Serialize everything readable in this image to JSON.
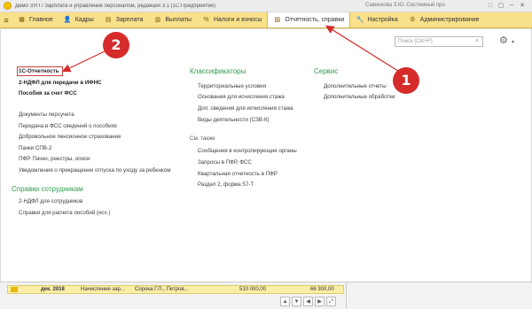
{
  "window": {
    "title": "Демо ЗУП / Зарплата и управление персоналом, редакция 3.1 (1С:Предприятие)",
    "user": "Савинкова З.Ю. Системный про",
    "controls": [
      "□",
      "▢",
      "─",
      "▢",
      "✕"
    ]
  },
  "menu": {
    "items": [
      {
        "label": "Главное",
        "icon": "▦"
      },
      {
        "label": "Кадры",
        "icon": "👤"
      },
      {
        "label": "Зарплата",
        "icon": "▤"
      },
      {
        "label": "Выплаты",
        "icon": "▥"
      },
      {
        "label": "Налоги и взносы",
        "icon": "%"
      },
      {
        "label": "Отчетность, справки",
        "icon": "▨"
      },
      {
        "label": "Настройка",
        "icon": "🔧"
      },
      {
        "label": "Администрирование",
        "icon": "⚙"
      }
    ]
  },
  "toolbar": {
    "search_placeholder": "Поиск (Ctrl+F)",
    "search_clear": "×",
    "settings_icon": "⚙",
    "settings_caret": "▾"
  },
  "reports": {
    "items": [
      {
        "label": "1С-Отчетность",
        "bold": true
      },
      {
        "label": "2-НДФЛ для передачи в ИФНС",
        "bold": true
      },
      {
        "label": "Пособия за счет ФСС",
        "bold": true
      },
      {
        "label": "Документы персучета",
        "bold": false
      },
      {
        "label": "Передача в ФСС сведений о пособиях",
        "bold": false
      },
      {
        "label": "Добровольное пенсионное страхование",
        "bold": false
      },
      {
        "label": "Пачки СПВ-2",
        "bold": false
      },
      {
        "label": "ПФР. Пачки, реестры, описи",
        "bold": false
      },
      {
        "label": "Уведомления о прекращении отпуска по уходу за ребенком",
        "bold": false
      }
    ]
  },
  "employee_certificates": {
    "heading": "Справки сотрудникам",
    "items": [
      "2-НДФЛ для сотрудников",
      "Справки для расчета пособий (исх.)"
    ]
  },
  "classifiers": {
    "heading": "Классификаторы",
    "items": [
      "Территориальные условия",
      "Основания для исчисления стажа",
      "Доп. сведения для исчисления стажа",
      "Виды деятельности (СЗВ-К)"
    ]
  },
  "see_also": {
    "heading": "См. также",
    "items": [
      "Сообщения в контролирующие органы",
      "Запросы в ПФР, ФСС",
      "Квартальная отчетность в ПФР",
      "Раздел 2, форма 57-Т"
    ]
  },
  "service": {
    "heading": "Сервис",
    "items": [
      "Дополнительные отчеты",
      "Дополнительные обработки"
    ]
  },
  "annotations": {
    "badge1": "1",
    "badge2": "2"
  },
  "bottom": {
    "period": "дек. 2018",
    "doc": "Начисление зар...",
    "employees": "Сорока Г.П., Петров...",
    "amount1": "510 000,00",
    "amount2": "66 300,00",
    "buttons": [
      "▲",
      "▼",
      "◀",
      "▶",
      "⤢"
    ]
  }
}
